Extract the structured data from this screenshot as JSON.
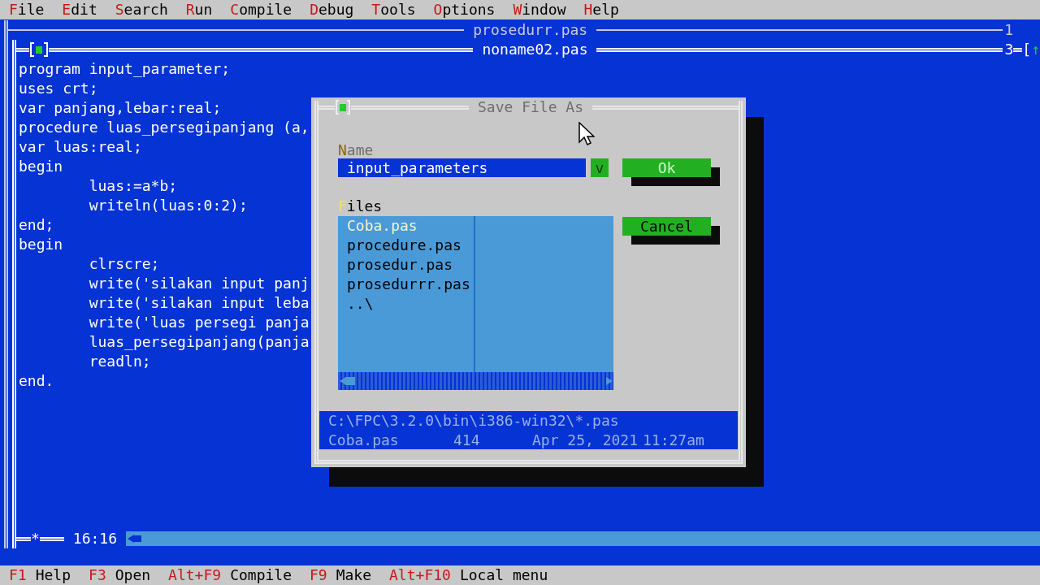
{
  "menu": [
    {
      "label": "File"
    },
    {
      "label": "Edit"
    },
    {
      "label": "Search"
    },
    {
      "label": "Run"
    },
    {
      "label": "Compile"
    },
    {
      "label": "Debug"
    },
    {
      "label": "Tools"
    },
    {
      "label": "Options"
    },
    {
      "label": "Window"
    },
    {
      "label": "Help"
    }
  ],
  "back_window": {
    "title": "prosedurr.pas",
    "number": "1"
  },
  "editor": {
    "title": "noname02.pas",
    "number": "3",
    "zoom_box": "[↑",
    "modified_mark": "*",
    "cursor": "16:16",
    "lines": [
      "program input_parameter;",
      "uses crt;",
      "var panjang,lebar:real;",
      "procedure luas_persegipanjang (a,",
      "var luas:real;",
      "begin",
      "        luas:=a*b;",
      "        writeln(luas:0:2);",
      "end;",
      "begin",
      "        clrscre;",
      "        write('silakan input panj",
      "        write('silakan input leba",
      "        write('luas persegi panja",
      "        luas_persegipanjang(panja",
      "        readln;",
      "end."
    ]
  },
  "dialog": {
    "title": "Save File As",
    "name_label": "Name",
    "name_value": "input_parameters",
    "history_button": "v",
    "files_label": "Files",
    "files": [
      {
        "label": "Coba.pas",
        "selected": true
      },
      {
        "label": "procedure.pas",
        "selected": false
      },
      {
        "label": "prosedur.pas",
        "selected": false
      },
      {
        "label": "prosedurrr.pas",
        "selected": false
      },
      {
        "label": "..\\",
        "selected": false
      }
    ],
    "buttons": [
      {
        "label": "Ok",
        "default": true
      },
      {
        "label": "Cancel",
        "default": false
      }
    ],
    "info": {
      "path": "C:\\FPC\\3.2.0\\bin\\i386-win32\\*.pas",
      "file": "Coba.pas",
      "size": "414",
      "date": "Apr 25, 2021",
      "time": "11:27am"
    }
  },
  "status_bar": [
    {
      "key": "F1",
      "label": "Help"
    },
    {
      "key": "F3",
      "label": "Open"
    },
    {
      "key": "Alt+F9",
      "label": "Compile"
    },
    {
      "key": "F9",
      "label": "Make"
    },
    {
      "key": "Alt+F10",
      "label": "Local menu"
    }
  ]
}
